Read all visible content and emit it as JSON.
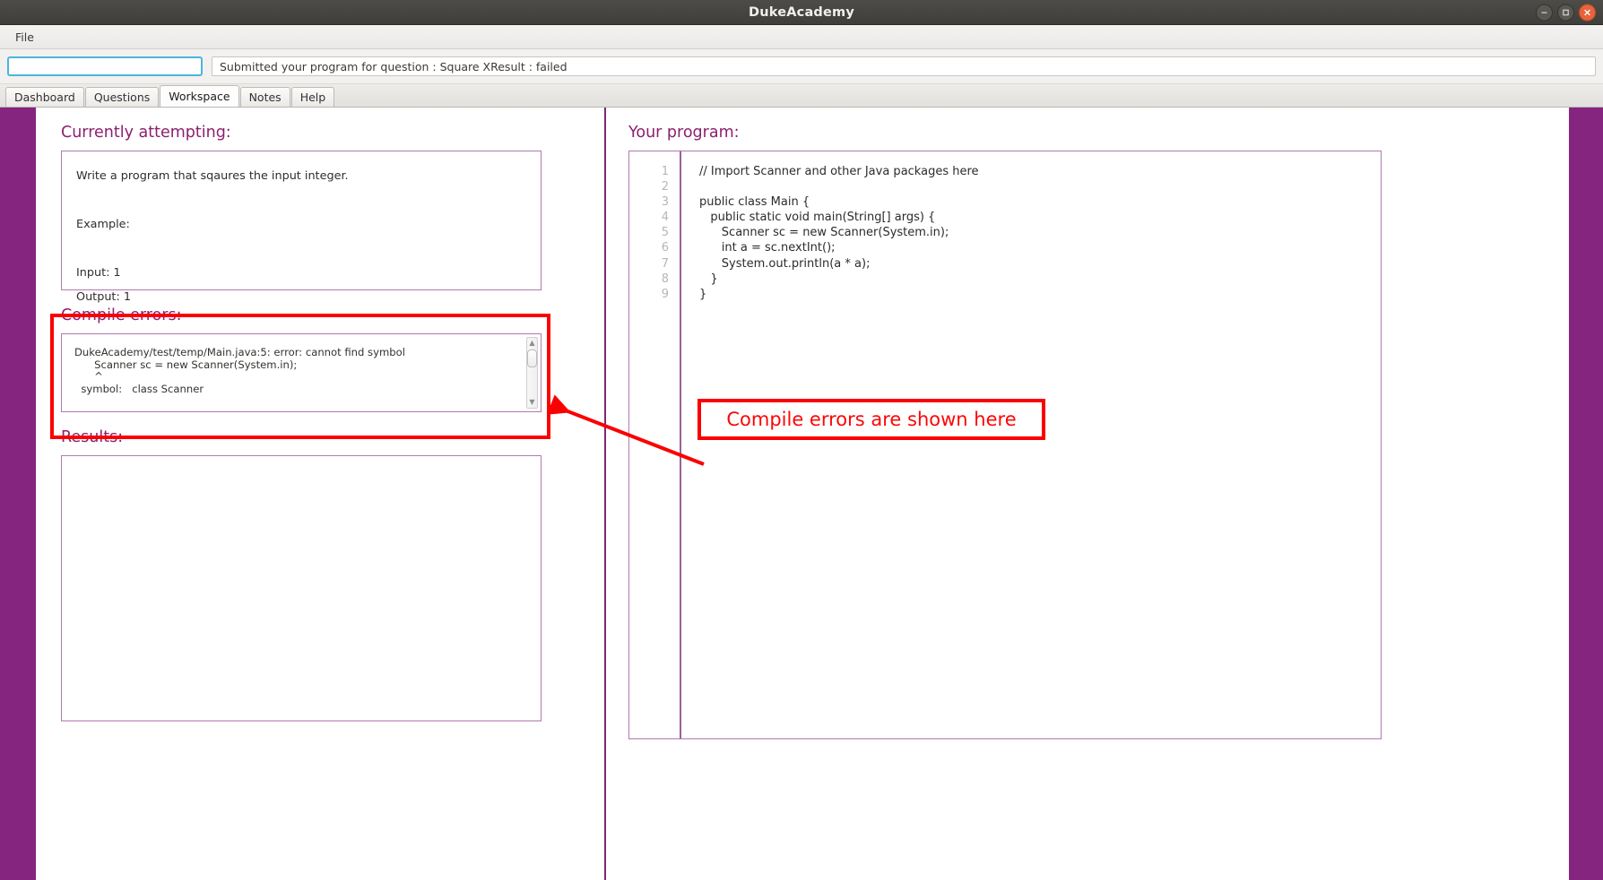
{
  "window": {
    "title": "DukeAcademy",
    "controls": [
      {
        "name": "minimize",
        "glyph": "–"
      },
      {
        "name": "maximize",
        "glyph": "□"
      },
      {
        "name": "close",
        "glyph": "✕"
      }
    ]
  },
  "menubar": {
    "items": [
      "File"
    ]
  },
  "toolbar": {
    "search_value": "",
    "search_placeholder": "",
    "status_text": "Submitted your program for question : Square XResult : failed"
  },
  "tabs": [
    {
      "label": "Dashboard",
      "active": false
    },
    {
      "label": "Questions",
      "active": false
    },
    {
      "label": "Workspace",
      "active": true
    },
    {
      "label": "Notes",
      "active": false
    },
    {
      "label": "Help",
      "active": false
    }
  ],
  "left_pane": {
    "problem": {
      "heading": "Currently attempting:",
      "body": "Write a program that sqaures the input integer.\n\nExample:\n\nInput: 1\nOutput: 1"
    },
    "compile_errors": {
      "heading": "Compile errors:",
      "body": "DukeAcademy/test/temp/Main.java:5: error: cannot find symbol\n      Scanner sc = new Scanner(System.in);\n      ^\n  symbol:   class Scanner"
    },
    "results": {
      "heading": "Results:",
      "body": ""
    }
  },
  "right_pane": {
    "heading": "Your program:",
    "line_numbers": [
      "1",
      "2",
      "3",
      "4",
      "5",
      "6",
      "7",
      "8",
      "9"
    ],
    "code_lines": [
      "// Import Scanner and other Java packages here",
      "",
      "public class Main {",
      "   public static void main(String[] args) {",
      "      Scanner sc = new Scanner(System.in);",
      "      int a = sc.nextInt();",
      "      System.out.println(a * a);",
      "   }",
      "}"
    ]
  },
  "annotations": {
    "callout_text": "Compile errors are shown here",
    "color": "#fa0000"
  },
  "colors": {
    "accent_purple": "#85257f",
    "heading_magenta": "#8c1f6e",
    "box_border": "#b07ab0",
    "annotation_red": "#fa0000",
    "search_focus_blue": "#4ab6e0"
  }
}
